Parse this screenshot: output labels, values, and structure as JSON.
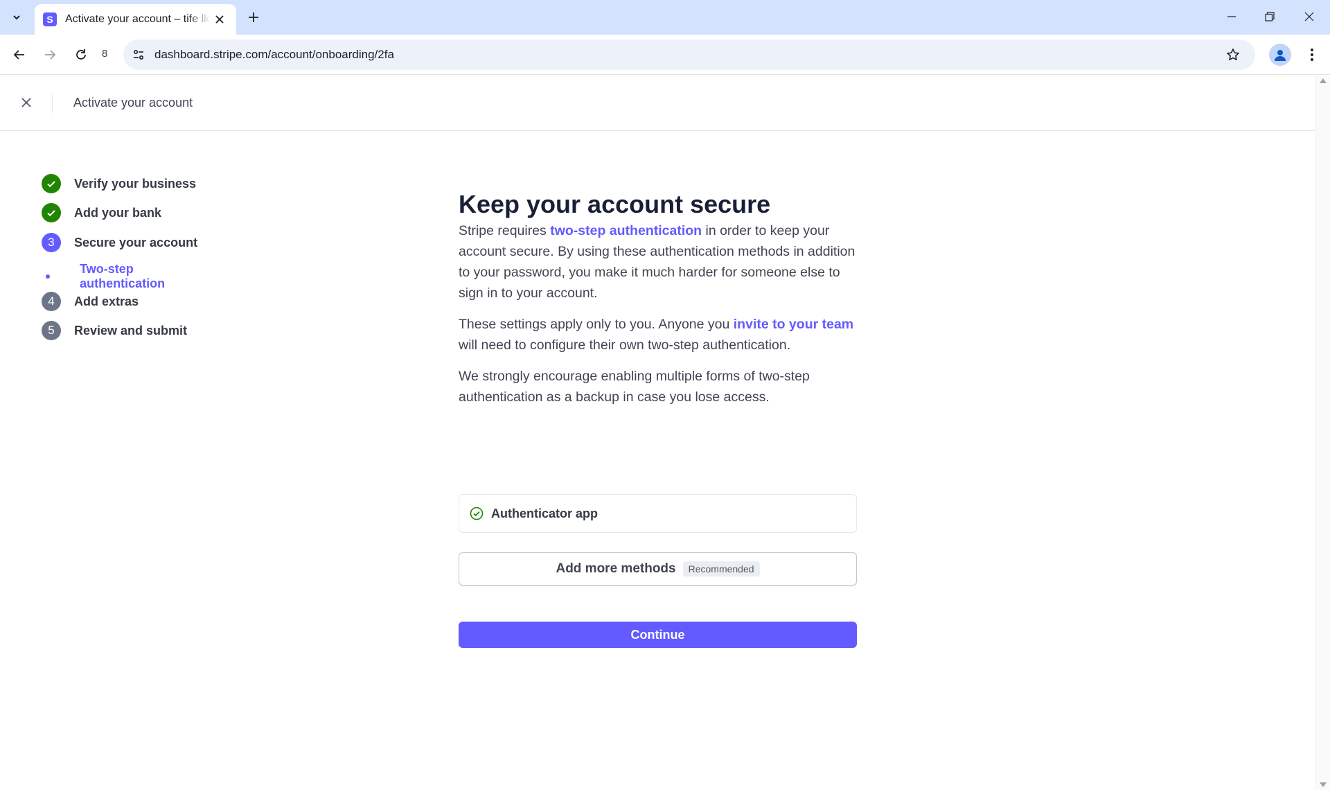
{
  "browser": {
    "tab_title": "Activate your account – tife llc –",
    "favicon_letter": "S",
    "url": "dashboard.stripe.com/account/onboarding/2fa",
    "reload_count": "8"
  },
  "header": {
    "title": "Activate your account"
  },
  "steps": [
    {
      "label": "Verify your business",
      "status": "done"
    },
    {
      "label": "Add your bank",
      "status": "done"
    },
    {
      "label": "Secure your account",
      "status": "current",
      "number": "3"
    },
    {
      "label": "Add extras",
      "status": "todo",
      "number": "4"
    },
    {
      "label": "Review and submit",
      "status": "todo",
      "number": "5"
    }
  ],
  "substep": {
    "label": "Two-step authentication"
  },
  "main": {
    "title": "Keep your account secure",
    "p1_before": "Stripe requires ",
    "p1_link": "two-step authentication",
    "p1_after": " in order to keep your account secure. By using these authentication methods in addition to your password, you make it much harder for someone else to sign in to your account.",
    "p2_before": "These settings apply only to you. Anyone you ",
    "p2_link": "invite to your team",
    "p2_after": " will need to configure their own two-step authentication.",
    "p3": "We strongly encourage enabling multiple forms of two-step authentication as a backup in case you lose access.",
    "method": "Authenticator app",
    "add_more": "Add more methods",
    "badge": "Recommended",
    "continue": "Continue"
  },
  "colors": {
    "accent": "#635bff",
    "success": "#228403",
    "text": "#414552"
  }
}
